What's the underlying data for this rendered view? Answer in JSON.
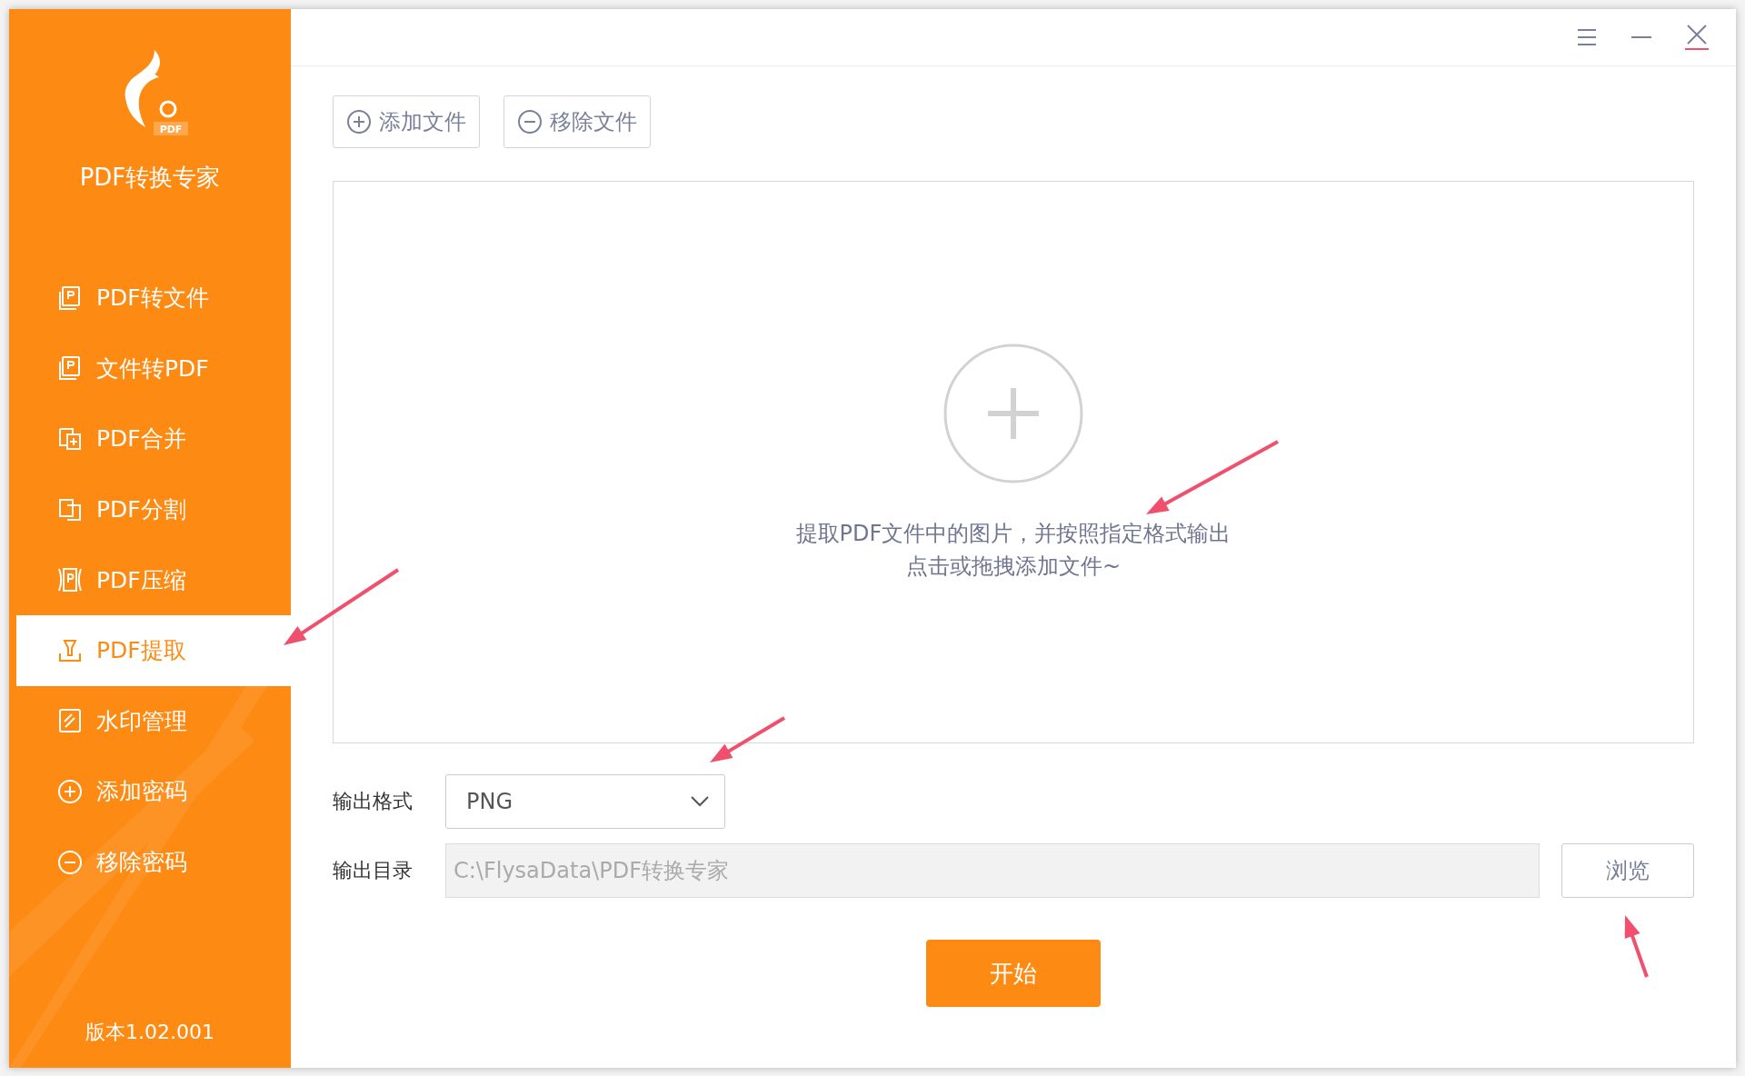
{
  "app": {
    "name": "PDF转换专家",
    "badge": "PDF",
    "version": "版本1.02.001"
  },
  "sidebar": {
    "items": [
      {
        "label": "PDF转文件",
        "kind": "doc",
        "selected": false
      },
      {
        "label": "文件转PDF",
        "kind": "doc",
        "selected": false
      },
      {
        "label": "PDF合并",
        "kind": "merge",
        "selected": false
      },
      {
        "label": "PDF分割",
        "kind": "split",
        "selected": false
      },
      {
        "label": "PDF压缩",
        "kind": "compress",
        "selected": false
      },
      {
        "label": "PDF提取",
        "kind": "extract",
        "selected": true
      },
      {
        "label": "水印管理",
        "kind": "watermark",
        "selected": false
      },
      {
        "label": "添加密码",
        "kind": "plus",
        "selected": false
      },
      {
        "label": "移除密码",
        "kind": "minus",
        "selected": false
      }
    ]
  },
  "toolbar": {
    "buttons": [
      {
        "label": "添加文件",
        "kind": "plus"
      },
      {
        "label": "移除文件",
        "kind": "minus"
      }
    ]
  },
  "drop_zone": {
    "lines": [
      "提取PDF文件中的图片，并按照指定格式输出",
      "点击或拖拽添加文件~"
    ]
  },
  "output": {
    "format_label": "输出格式",
    "format_value": "PNG",
    "dir_label": "输出目录",
    "dir_value": "C:\\FlysaData\\PDF转换专家",
    "browse": "浏览"
  },
  "start_button": "开始"
}
